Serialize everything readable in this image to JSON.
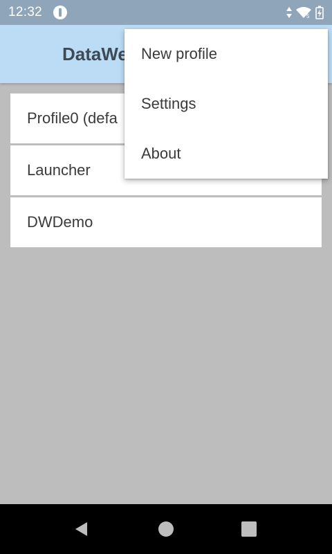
{
  "status_bar": {
    "time": "12:32",
    "app_icon": "app-notification-icon",
    "icons": [
      "data-arrows-icon",
      "wifi-icon",
      "battery-charging-icon"
    ]
  },
  "app_bar": {
    "title": "DataWe"
  },
  "profiles": {
    "items": [
      {
        "label": "Profile0 (defa"
      },
      {
        "label": "Launcher"
      },
      {
        "label": "DWDemo"
      }
    ]
  },
  "menu": {
    "items": [
      {
        "label": "New profile"
      },
      {
        "label": "Settings"
      },
      {
        "label": "About"
      }
    ]
  },
  "nav_bar": {
    "buttons": [
      "back-icon",
      "home-icon",
      "recents-icon"
    ]
  },
  "colors": {
    "status_bar": "#8fa6ba",
    "app_bar": "#bcdcf5",
    "background": "#bdbdbd",
    "nav_bar": "#000000"
  }
}
